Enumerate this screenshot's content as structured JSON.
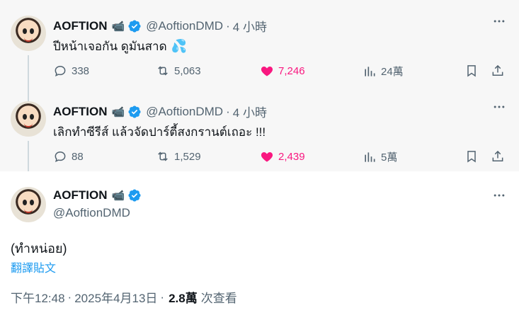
{
  "accent_color": "#1d9bf0",
  "like_color": "#f91880",
  "author": {
    "name": "AOFTION",
    "camera_emoji": "📹",
    "verified": true,
    "handle": "@AoftionDMD"
  },
  "replies": [
    {
      "time": "4 小時",
      "text": "ปีหน้าเจอกัน ดูมันสาด",
      "emoji": "💦",
      "stats": {
        "replies": "338",
        "retweets": "5,063",
        "likes": "7,246",
        "views": "24萬"
      }
    },
    {
      "time": "4 小時",
      "text": "เลิกทำซีรีส์ แล้วจัดปาร์ตี้สงกรานต์เถอะ !!!",
      "emoji": "",
      "stats": {
        "replies": "88",
        "retweets": "1,529",
        "likes": "2,439",
        "views": "5萬"
      }
    }
  ],
  "main_tweet": {
    "text": "(ทำหน่อย)",
    "translate_label": "翻譯貼文",
    "timestamp": "下午12:48",
    "date": "2025年4月13日",
    "views_count": "2.8萬",
    "views_label": "次查看"
  }
}
